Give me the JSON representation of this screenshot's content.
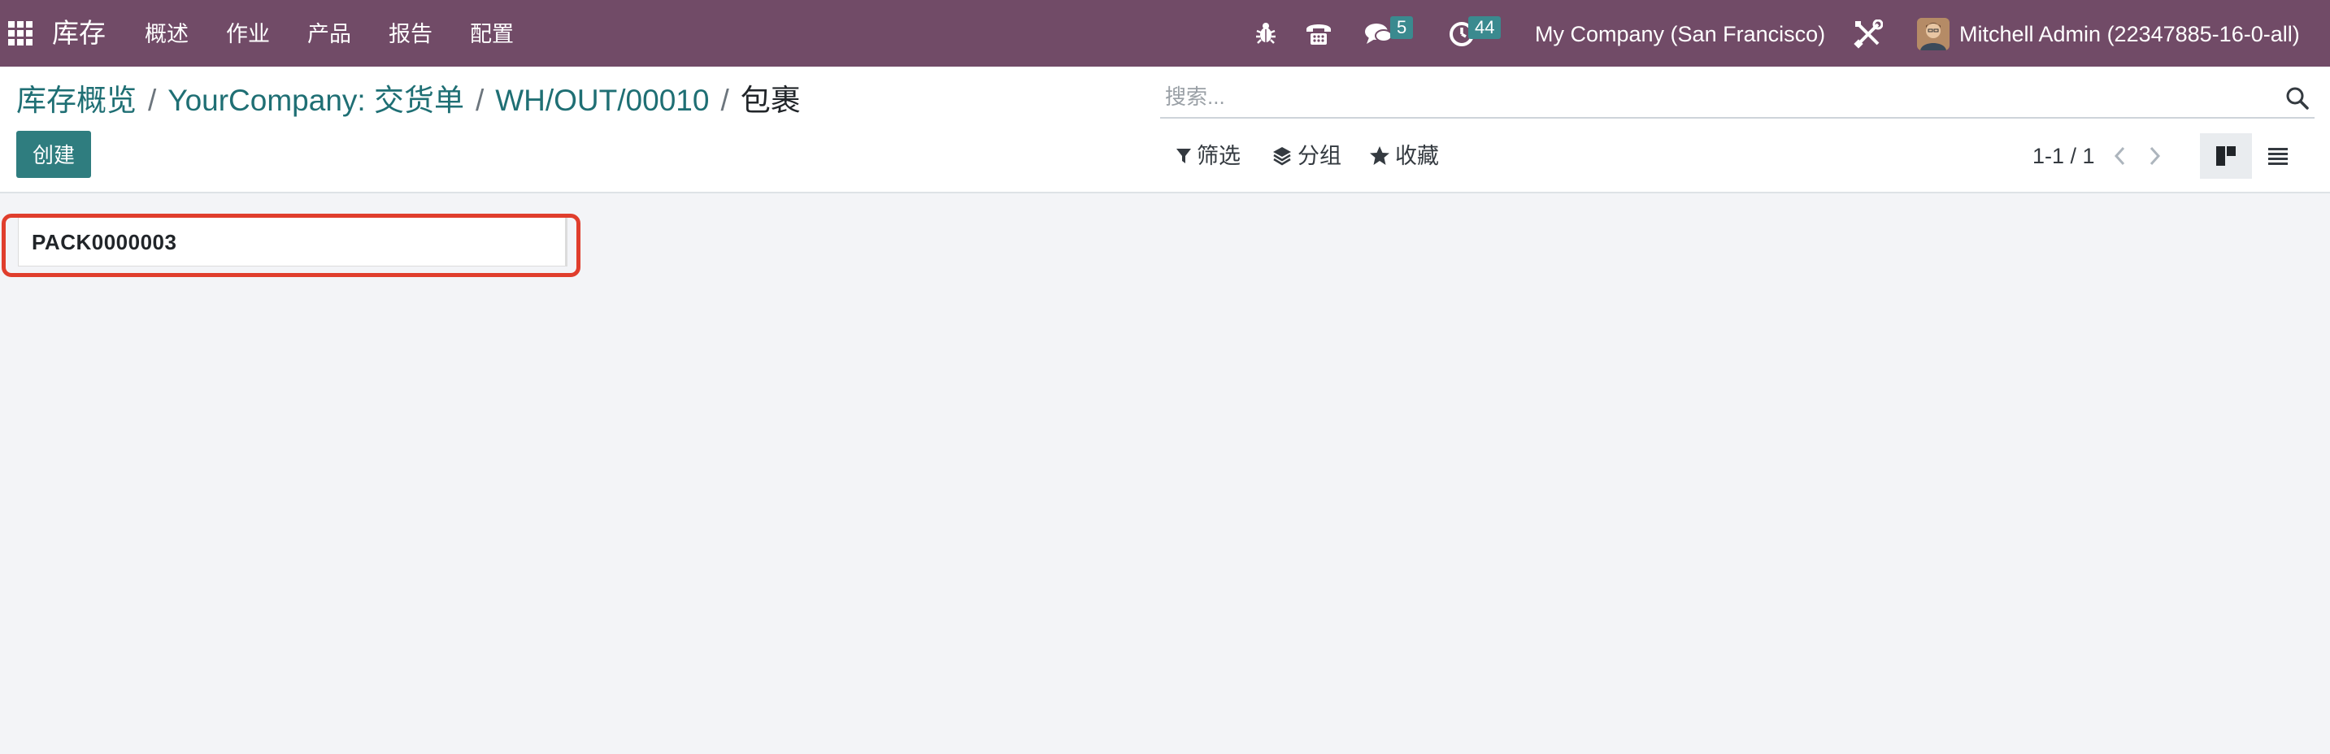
{
  "navbar": {
    "apps_icon": "apps-grid-icon",
    "brand": "库存",
    "menu": [
      {
        "label": "概述"
      },
      {
        "label": "作业"
      },
      {
        "label": "产品"
      },
      {
        "label": "报告"
      },
      {
        "label": "配置"
      }
    ],
    "debug_icon": "bug-icon",
    "phone_icon": "phone-icon",
    "messages_icon": "chat-icon",
    "messages_count": "5",
    "activities_icon": "clock-icon",
    "activities_count": "44",
    "company": "My Company (San Francisco)",
    "settings_icon": "tools-icon",
    "user_name": "Mitchell Admin (22347885-16-0-all)"
  },
  "breadcrumb": [
    {
      "label": "库存概览"
    },
    {
      "label": "YourCompany: 交货单"
    },
    {
      "label": "WH/OUT/00010"
    },
    {
      "label": "包裹"
    }
  ],
  "control_panel": {
    "create_label": "创建",
    "search_placeholder": "搜索...",
    "filter_label": "筛选",
    "groupby_label": "分组",
    "favorites_label": "收藏",
    "pager_text": "1-1 / 1"
  },
  "kanban": {
    "records": [
      {
        "name": "PACK0000003"
      }
    ]
  },
  "colors": {
    "navbar_bg": "#714b67",
    "primary": "#2f7d7f",
    "badge": "#3a8a8f",
    "highlight": "#e03e2d"
  }
}
